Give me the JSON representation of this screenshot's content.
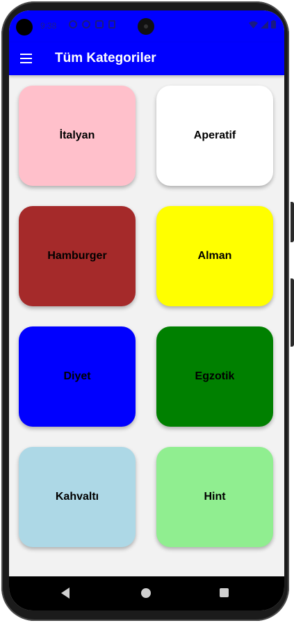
{
  "status_bar": {
    "time": "9:38",
    "icons": [
      "settings-icon",
      "sync-icon",
      "shield-icon",
      "sd-card-icon"
    ],
    "right_icons": [
      "wifi-icon",
      "signal-icon",
      "battery-icon"
    ]
  },
  "app_bar": {
    "menu_icon": "hamburger-menu-icon",
    "title": "Tüm Kategoriler",
    "color": "#0000ff"
  },
  "categories": [
    {
      "label": "İtalyan",
      "color": "#ffc0cb"
    },
    {
      "label": "Aperatif",
      "color": "#ffffff"
    },
    {
      "label": "Hamburger",
      "color": "#a52a2a"
    },
    {
      "label": "Alman",
      "color": "#ffff00"
    },
    {
      "label": "Diyet",
      "color": "#0000ff"
    },
    {
      "label": "Egzotik",
      "color": "#008000"
    },
    {
      "label": "Kahvaltı",
      "color": "#add8e6"
    },
    {
      "label": "Hint",
      "color": "#90ee90"
    }
  ],
  "nav_bar": {
    "buttons": [
      "back-icon",
      "home-icon",
      "recents-icon"
    ]
  }
}
